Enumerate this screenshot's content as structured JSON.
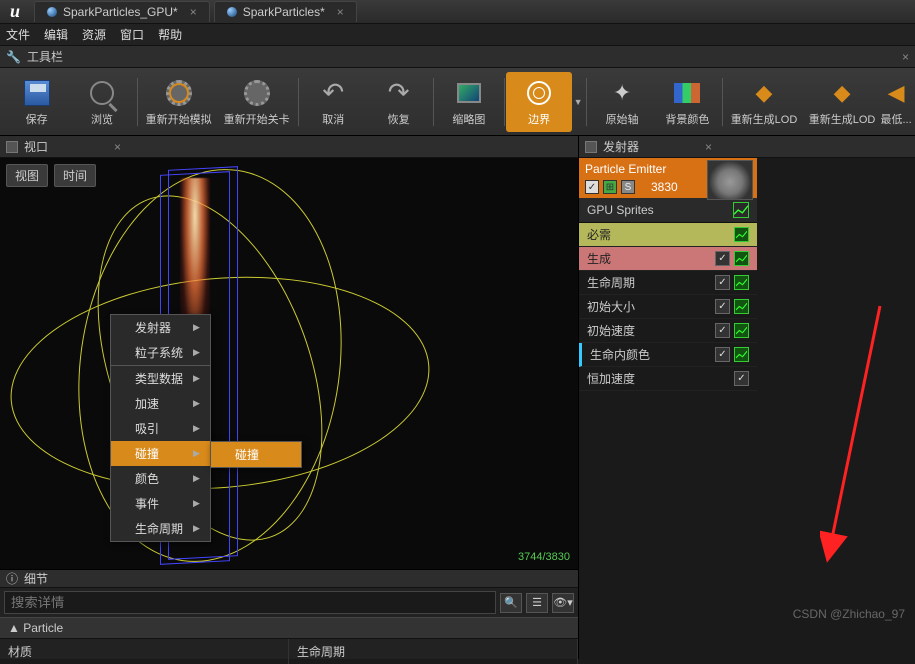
{
  "tabs": [
    {
      "label": "SparkParticles_GPU*"
    },
    {
      "label": "SparkParticles*"
    }
  ],
  "menu": {
    "file": "文件",
    "edit": "编辑",
    "asset": "资源",
    "window": "窗口",
    "help": "帮助"
  },
  "toolstrip": {
    "header": "工具栏"
  },
  "toolbar": {
    "save": "保存",
    "browse": "浏览",
    "restartSim": "重新开始模拟",
    "restartLevel": "重新开始关卡",
    "undo": "取消",
    "redo": "恢复",
    "thumb": "缩略图",
    "bounds": "边界",
    "originAxis": "原始轴",
    "bgColor": "背景颜色",
    "regenLOD1": "重新生成LOD",
    "regenLOD2": "重新生成LOD",
    "lowest": "最低..."
  },
  "viewport": {
    "tab": "视口",
    "viewBtn": "视图",
    "timeBtn": "时间",
    "stats": "3744/3830"
  },
  "details": {
    "tab": "细节",
    "searchPlaceholder": "搜索详情",
    "section": "Particle",
    "row1": "材质",
    "row2": "生命周期"
  },
  "emitters": {
    "tab": "发射器",
    "name": "Particle Emitter",
    "count": "3830",
    "typeData": "GPU Sprites",
    "modules": {
      "required": "必需",
      "spawn": "生成",
      "lifetime": "生命周期",
      "initSize": "初始大小",
      "initVel": "初始速度",
      "colorLife": "生命内颜色",
      "constAccel": "恒加速度"
    }
  },
  "contextMenu": {
    "items": {
      "emitter": "发射器",
      "psys": "粒子系统",
      "typeData": "类型数据",
      "accel": "加速",
      "attract": "吸引",
      "collision": "碰撞",
      "color": "颜色",
      "event": "事件",
      "lifetime": "生命周期"
    },
    "sub": {
      "collision": "碰撞"
    }
  },
  "watermark": "CSDN @Zhichao_97"
}
